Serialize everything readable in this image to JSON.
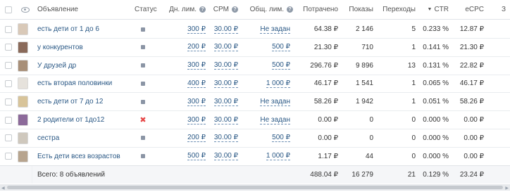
{
  "header": {
    "name": "Объявление",
    "status": "Статус",
    "day_limit": "Дн. лим.",
    "cpm": "CPM",
    "total_limit": "Общ. лим.",
    "spent": "Потрачено",
    "impressions": "Показы",
    "clicks": "Переходы",
    "ctr": "CTR",
    "ecpc": "eCPC",
    "extra": "З",
    "help_glyph": "?",
    "sort_glyph": "▼"
  },
  "rows": [
    {
      "name": "есть дети от 1 до 6",
      "status": "active",
      "day_limit": "300 ₽",
      "cpm": "30.00 ₽",
      "total_limit": "Не задан",
      "spent": "64.38 ₽",
      "impressions": "2 146",
      "clicks": "5",
      "ctr": "0.233 %",
      "ecpc": "12.87 ₽",
      "thumb_color": "#d9c9b8"
    },
    {
      "name": "у конкурентов",
      "status": "active",
      "day_limit": "200 ₽",
      "cpm": "30.00 ₽",
      "total_limit": "500 ₽",
      "spent": "21.30 ₽",
      "impressions": "710",
      "clicks": "1",
      "ctr": "0.141 %",
      "ecpc": "21.30 ₽",
      "thumb_color": "#8a6a5a"
    },
    {
      "name": "У друзей др",
      "status": "active",
      "day_limit": "300 ₽",
      "cpm": "30.00 ₽",
      "total_limit": "500 ₽",
      "spent": "296.76 ₽",
      "impressions": "9 896",
      "clicks": "13",
      "ctr": "0.131 %",
      "ecpc": "22.82 ₽",
      "thumb_color": "#a88f78"
    },
    {
      "name": "есть вторая половинки",
      "status": "active",
      "day_limit": "400 ₽",
      "cpm": "30.00 ₽",
      "total_limit": "1 000 ₽",
      "spent": "46.17 ₽",
      "impressions": "1 541",
      "clicks": "1",
      "ctr": "0.065 %",
      "ecpc": "46.17 ₽",
      "thumb_color": "#e6e2dc"
    },
    {
      "name": "есть дети от 7 до 12",
      "status": "active",
      "day_limit": "300 ₽",
      "cpm": "30.00 ₽",
      "total_limit": "Не задан",
      "spent": "58.26 ₽",
      "impressions": "1 942",
      "clicks": "1",
      "ctr": "0.051 %",
      "ecpc": "58.26 ₽",
      "thumb_color": "#d8c49a"
    },
    {
      "name": "2 родители от 1до12",
      "status": "stopped",
      "day_limit": "300 ₽",
      "cpm": "30.00 ₽",
      "total_limit": "Не задан",
      "spent": "0.00 ₽",
      "impressions": "0",
      "clicks": "0",
      "ctr": "0.000 %",
      "ecpc": "0.00 ₽",
      "thumb_color": "#8c6a9a"
    },
    {
      "name": "сестра",
      "status": "active",
      "day_limit": "200 ₽",
      "cpm": "30.00 ₽",
      "total_limit": "500 ₽",
      "spent": "0.00 ₽",
      "impressions": "0",
      "clicks": "0",
      "ctr": "0.000 %",
      "ecpc": "0.00 ₽",
      "thumb_color": "#cfc8bd"
    },
    {
      "name": "Есть дети всез возрастов",
      "status": "active",
      "day_limit": "500 ₽",
      "cpm": "30.00 ₽",
      "total_limit": "1 000 ₽",
      "spent": "1.17 ₽",
      "impressions": "44",
      "clicks": "0",
      "ctr": "0.000 %",
      "ecpc": "0.00 ₽",
      "thumb_color": "#b7a48e"
    }
  ],
  "total": {
    "label": "Всего: 8 объявлений",
    "spent": "488.04 ₽",
    "impressions": "16 279",
    "clicks": "21",
    "ctr": "0.129 %",
    "ecpc": "23.24 ₽"
  },
  "colors": {
    "link": "#2a5885",
    "stopped": "#e64646",
    "status_active": "#8b95a5"
  }
}
